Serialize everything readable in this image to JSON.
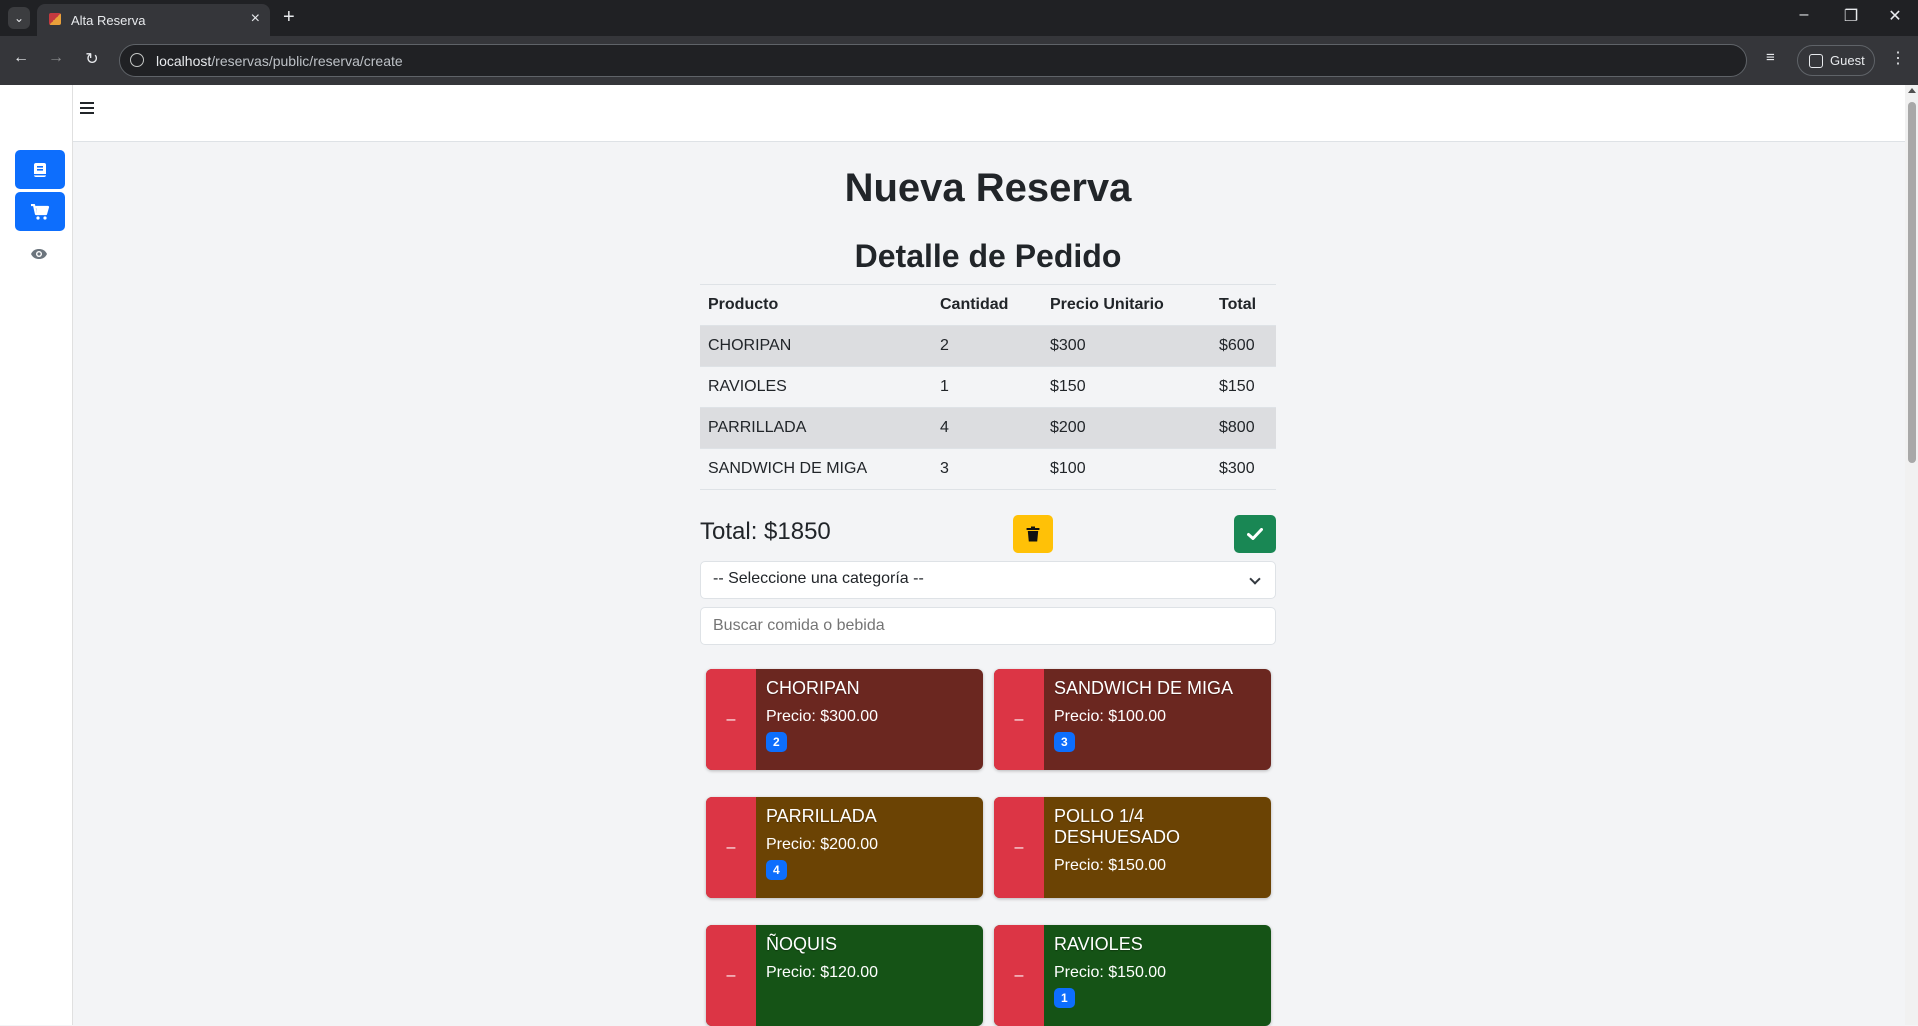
{
  "browser": {
    "tab_title": "Alta Reserva",
    "url_host": "localhost",
    "url_path": "/reservas/public/reserva/create",
    "profile_label": "Guest"
  },
  "page": {
    "title": "Nueva Reserva",
    "subtitle": "Detalle de Pedido"
  },
  "order_table": {
    "headers": [
      "Producto",
      "Cantidad",
      "Precio Unitario",
      "Total"
    ],
    "rows": [
      [
        "CHORIPAN",
        "2",
        "$300",
        "$600"
      ],
      [
        "RAVIOLES",
        "1",
        "$150",
        "$150"
      ],
      [
        "PARRILLADA",
        "4",
        "$200",
        "$800"
      ],
      [
        "SANDWICH DE MIGA",
        "3",
        "$100",
        "$300"
      ]
    ]
  },
  "summary": {
    "total_label": "Total: $1850"
  },
  "filters": {
    "category_selected": "-- Seleccione una categoría --",
    "search_placeholder": "Buscar comida o bebida"
  },
  "products": [
    {
      "name": "CHORIPAN",
      "price": "Precio: $300.00",
      "qty": "2",
      "minus": "–",
      "color": "#6b2720"
    },
    {
      "name": "SANDWICH DE MIGA",
      "price": "Precio: $100.00",
      "qty": "3",
      "minus": "–",
      "color": "#6b2720"
    },
    {
      "name": "PARRILLADA",
      "price": "Precio: $200.00",
      "qty": "4",
      "minus": "–",
      "color": "#6b4304"
    },
    {
      "name": "POLLO 1/4 DESHUESADO",
      "price": "Precio: $150.00",
      "qty": "",
      "minus": "–",
      "color": "#6b4304"
    },
    {
      "name": "ÑOQUIS",
      "price": "Precio: $120.00",
      "qty": "",
      "minus": "–",
      "color": "#155316"
    },
    {
      "name": "RAVIOLES",
      "price": "Precio: $150.00",
      "qty": "1",
      "minus": "–",
      "color": "#155316"
    }
  ],
  "colors": {
    "primary": "#0d6efd",
    "warning": "#ffc107",
    "success": "#198754",
    "danger": "#dc3545"
  }
}
